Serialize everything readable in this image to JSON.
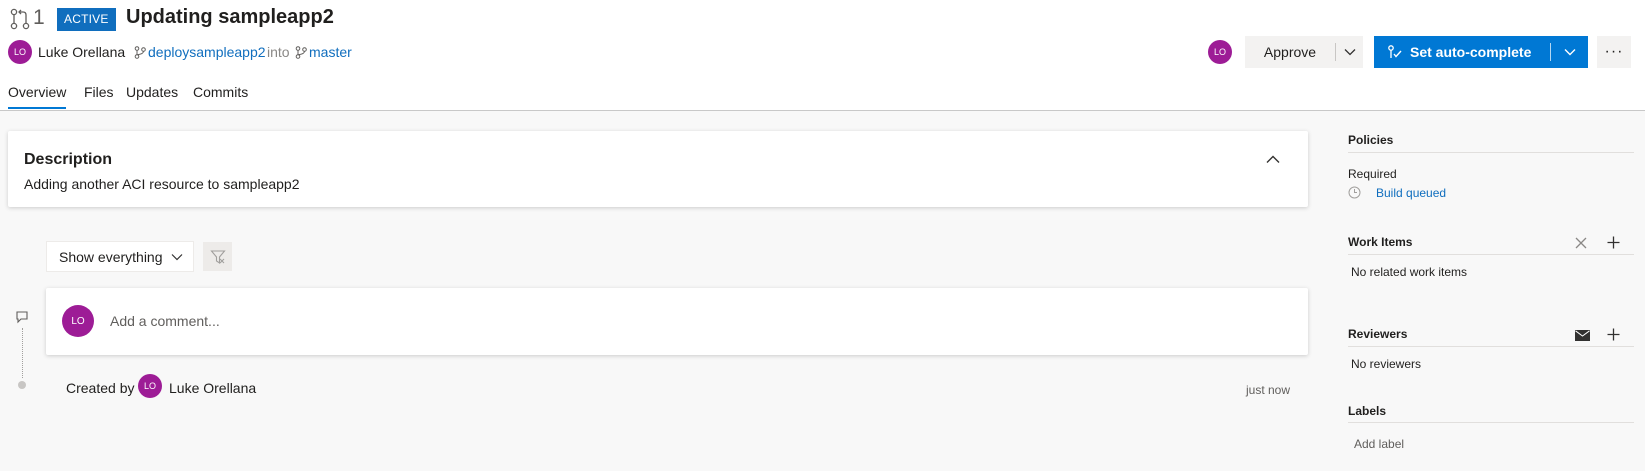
{
  "header": {
    "pr_number": "1",
    "status_badge": "ACTIVE",
    "title": "Updating sampleapp2",
    "author_initials": "LO",
    "author_name": "Luke Orellana",
    "source_branch": "deploysampleapp2",
    "into_text": "into",
    "target_branch": "master",
    "reviewer_initials": "LO",
    "approve_label": "Approve",
    "autocomplete_label": "Set auto-complete",
    "more_label": "···"
  },
  "tabs": [
    {
      "label": "Overview"
    },
    {
      "label": "Files"
    },
    {
      "label": "Updates"
    },
    {
      "label": "Commits"
    }
  ],
  "description": {
    "heading": "Description",
    "text": "Adding another ACI resource to sampleapp2"
  },
  "activity": {
    "filter_label": "Show everything",
    "comment_initials": "LO",
    "comment_placeholder": "Add a comment...",
    "created_by_label": "Created by",
    "created_initials": "LO",
    "created_name": "Luke Orellana",
    "created_time": "just now"
  },
  "sidebar": {
    "policies_heading": "Policies",
    "required_label": "Required",
    "build_status": "Build queued",
    "work_items_heading": "Work Items",
    "work_items_empty": "No related work items",
    "reviewers_heading": "Reviewers",
    "reviewers_empty": "No reviewers",
    "labels_heading": "Labels",
    "add_label": "Add label"
  },
  "colors": {
    "accent": "#0078d4",
    "link": "#106ebe",
    "avatar": "#9d1c96"
  }
}
